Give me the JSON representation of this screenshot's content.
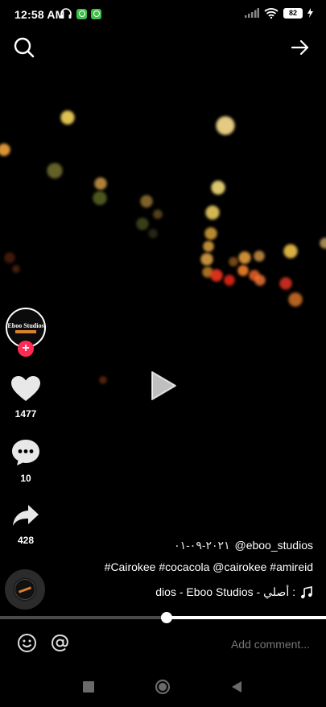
{
  "status_bar": {
    "time": "12:58 AM",
    "battery": "82",
    "icons": [
      "headphones-icon",
      "app-notification-icon",
      "app-notification-icon",
      "signal-icon",
      "wifi-icon",
      "battery-icon",
      "charging-icon"
    ]
  },
  "top_bar": {
    "left_icon": "search-icon",
    "right_icon": "arrow-right-icon"
  },
  "video": {
    "playing": false
  },
  "actions": {
    "likes": "1477",
    "comments": "10",
    "shares": "428"
  },
  "avatar": {
    "label": "Eboo Studios"
  },
  "caption": {
    "date": "٢٠٢١-٠٩-٠١",
    "username": "@eboo_studios",
    "hashtags": "#Cairokee #cocacola @cairokee #amireid",
    "music": "dios - Eboo Studios - أصلي :"
  },
  "progress": {
    "fraction": 0.51
  },
  "comment": {
    "placeholder": "Add comment..."
  },
  "colors": {
    "follow": "#fe2c55",
    "brand_orange": "#d9822b"
  }
}
